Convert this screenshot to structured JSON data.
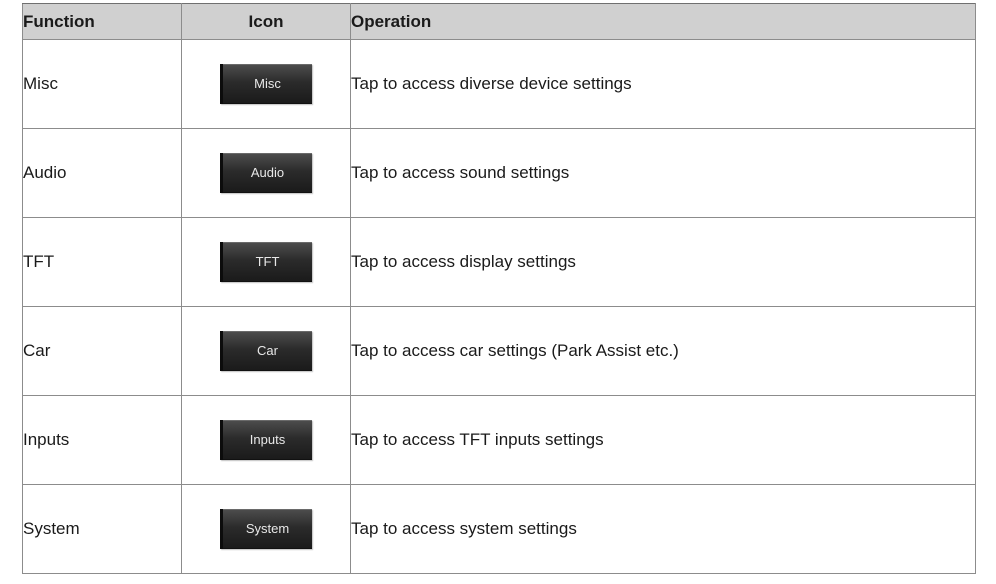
{
  "table": {
    "headers": {
      "function": "Function",
      "icon": "Icon",
      "operation": "Operation"
    },
    "rows": [
      {
        "function": "Misc",
        "icon_label": "Misc",
        "icon_name": "misc-button-icon",
        "operation": "Tap to access diverse device settings"
      },
      {
        "function": "Audio",
        "icon_label": "Audio",
        "icon_name": "audio-button-icon",
        "operation": "Tap to access sound settings"
      },
      {
        "function": "TFT",
        "icon_label": "TFT",
        "icon_name": "tft-button-icon",
        "operation": "Tap to access display settings"
      },
      {
        "function": "Car",
        "icon_label": "Car",
        "icon_name": "car-button-icon",
        "operation": "Tap to access car settings (Park Assist etc.)"
      },
      {
        "function": "Inputs",
        "icon_label": "Inputs",
        "icon_name": "inputs-button-icon",
        "operation": "Tap to access TFT inputs settings"
      },
      {
        "function": "System",
        "icon_label": "System",
        "icon_name": "system-button-icon",
        "operation": "Tap to access system settings"
      }
    ]
  },
  "colors": {
    "header_background": "#d0d0d0",
    "border": "#8c8c8c",
    "tile_dark": "#1a1a1a",
    "tile_text": "#e8e8e8"
  }
}
